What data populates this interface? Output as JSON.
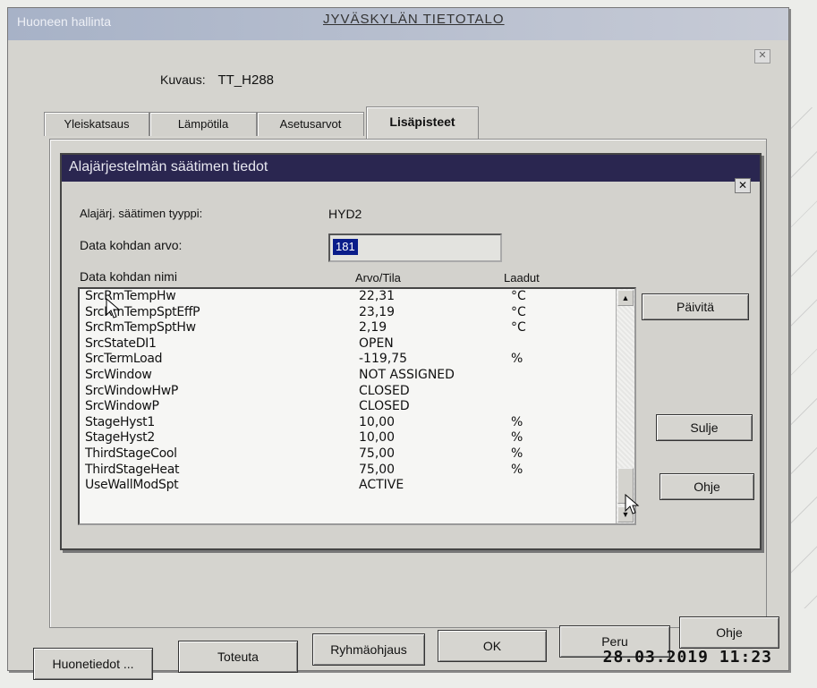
{
  "outer_window": {
    "title": "Huoneen hallinta",
    "brand": "JYVÄSKYLÄN TIETOTALO",
    "close_label": "✕",
    "description_label": "Kuvaus:",
    "description_value": "TT_H288",
    "tabs": [
      {
        "label": "Yleiskatsaus"
      },
      {
        "label": "Lämpötila"
      },
      {
        "label": "Asetusarvot"
      },
      {
        "label": "Lisäpisteet"
      }
    ]
  },
  "dialog": {
    "title": "Alajärjestelmän säätimen tiedot",
    "close_label": "✕",
    "type_label": "Alajärj. säätimen tyyppi:",
    "type_value": "HYD2",
    "data_value_label": "Data kohdan arvo:",
    "data_value": "181",
    "columns": {
      "name": "Data kohdan nimi",
      "value": "Arvo/Tila",
      "unit": "Laadut"
    },
    "rows": [
      {
        "name": "SrcRmTempHw",
        "value": "22,31",
        "unit": "°C"
      },
      {
        "name": "SrcRmTempSptEffP",
        "value": "23,19",
        "unit": "°C"
      },
      {
        "name": "SrcRmTempSptHw",
        "value": "2,19",
        "unit": "°C"
      },
      {
        "name": "SrcStateDI1",
        "value": "OPEN",
        "unit": ""
      },
      {
        "name": "SrcTermLoad",
        "value": "-119,75",
        "unit": "%"
      },
      {
        "name": "SrcWindow",
        "value": "NOT ASSIGNED",
        "unit": ""
      },
      {
        "name": "SrcWindowHwP",
        "value": "CLOSED",
        "unit": ""
      },
      {
        "name": "SrcWindowP",
        "value": "CLOSED",
        "unit": ""
      },
      {
        "name": "StageHyst1",
        "value": "10,00",
        "unit": "%"
      },
      {
        "name": "StageHyst2",
        "value": "10,00",
        "unit": "%"
      },
      {
        "name": "ThirdStageCool",
        "value": "75,00",
        "unit": "%"
      },
      {
        "name": "ThirdStageHeat",
        "value": "75,00",
        "unit": "%"
      },
      {
        "name": "UseWallModSpt",
        "value": "ACTIVE",
        "unit": ""
      }
    ],
    "buttons": {
      "refresh": "Päivitä",
      "close": "Sulje",
      "help": "Ohje"
    }
  },
  "footer": {
    "buttons": [
      "Huonetiedot ...",
      "Toteuta",
      "Ryhmäohjaus",
      "OK",
      "Peru",
      "Ohje"
    ],
    "timestamp": "28.03.2019 11:23"
  }
}
